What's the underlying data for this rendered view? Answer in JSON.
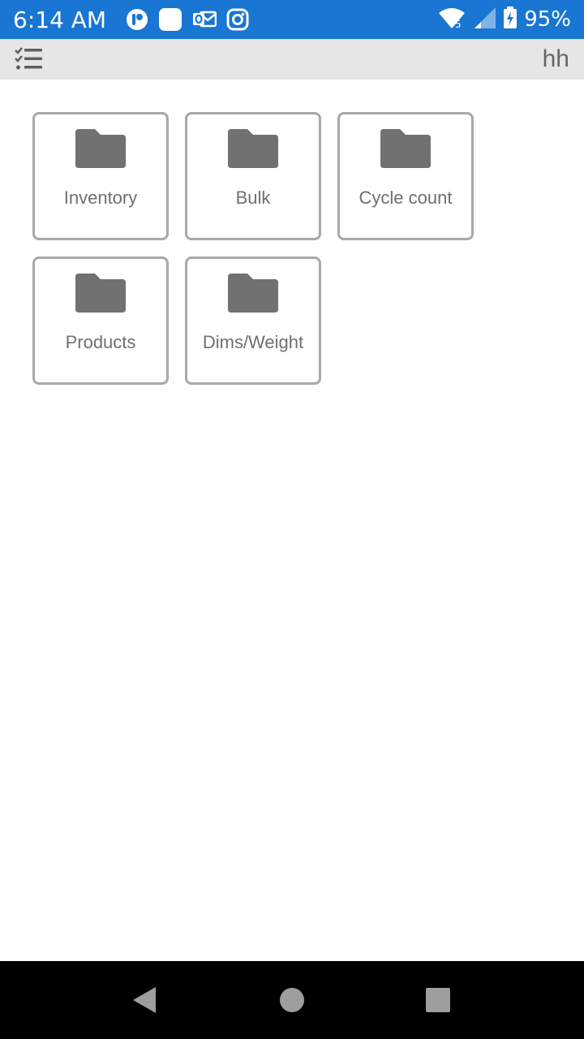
{
  "status_bar": {
    "time": "6:14 AM",
    "battery": "95%",
    "network_badge": "5",
    "left_icons": [
      "app-notification-icon",
      "blank-app-icon",
      "outlook-icon",
      "instagram-icon"
    ],
    "right_icons": [
      "wifi-icon",
      "cell-signal-icon",
      "battery-charging-icon"
    ]
  },
  "toolbar": {
    "menu_icon": "checklist-icon",
    "user": "hh"
  },
  "tiles": [
    {
      "label": "Inventory",
      "icon": "folder-icon"
    },
    {
      "label": "Bulk",
      "icon": "folder-icon"
    },
    {
      "label": "Cycle count",
      "icon": "folder-icon"
    },
    {
      "label": "Products",
      "icon": "folder-icon"
    },
    {
      "label": "Dims/Weight",
      "icon": "folder-icon"
    }
  ],
  "nav_bar": {
    "buttons": [
      "back-icon",
      "home-icon",
      "recents-icon"
    ]
  },
  "colors": {
    "status_bar": "#1976d2",
    "toolbar": "#e6e6e6",
    "tile_border": "#a8a8a8",
    "folder": "#717171",
    "text": "#6f6f6f"
  }
}
